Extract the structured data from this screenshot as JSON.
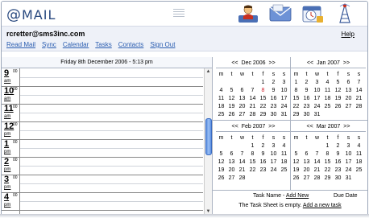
{
  "app": {
    "logo_at": "@",
    "logo_text": "MAIL"
  },
  "nav_icons": [
    "contacts-icon",
    "mail-icon",
    "calendar-icon",
    "tasks-icon"
  ],
  "user": {
    "email": "rcretter@sms3inc.com",
    "help": "Help"
  },
  "menu": [
    "Read Mail",
    "Sync",
    "Calendar",
    "Tasks",
    "Contacts",
    "Sign Out"
  ],
  "day_view": {
    "title": "Friday 8th December 2006 - 5:13 pm",
    "minute_label": "00",
    "hours": [
      {
        "num": "9",
        "ampm": "am"
      },
      {
        "num": "10",
        "ampm": "am"
      },
      {
        "num": "11",
        "ampm": "am"
      },
      {
        "num": "12",
        "ampm": "pm"
      },
      {
        "num": "1",
        "ampm": "pm"
      },
      {
        "num": "2",
        "ampm": "pm"
      },
      {
        "num": "3",
        "ampm": "pm"
      },
      {
        "num": "4",
        "ampm": "pm"
      }
    ]
  },
  "calendars": {
    "prev": "<<",
    "next": ">>",
    "weekdays": [
      "m",
      "t",
      "w",
      "t",
      "f",
      "s",
      "s"
    ],
    "months": [
      {
        "title": "Dec 2006",
        "offset": 4,
        "days": 31,
        "today": 8
      },
      {
        "title": "Jan 2007",
        "offset": 0,
        "days": 31,
        "today": null
      },
      {
        "title": "Feb 2007",
        "offset": 3,
        "days": 28,
        "today": null
      },
      {
        "title": "Mar 2007",
        "offset": 3,
        "days": 31,
        "today": null
      }
    ]
  },
  "tasks": {
    "name_label": "Task Name - ",
    "add_new": "Add New",
    "due_label": "Due Date",
    "empty_text": "The Task Sheet is empty. ",
    "add_task": "Add a new task"
  },
  "colors": {
    "accent": "#2a5db0",
    "today": "#d0202a",
    "header_bg": "#eef1f8"
  }
}
